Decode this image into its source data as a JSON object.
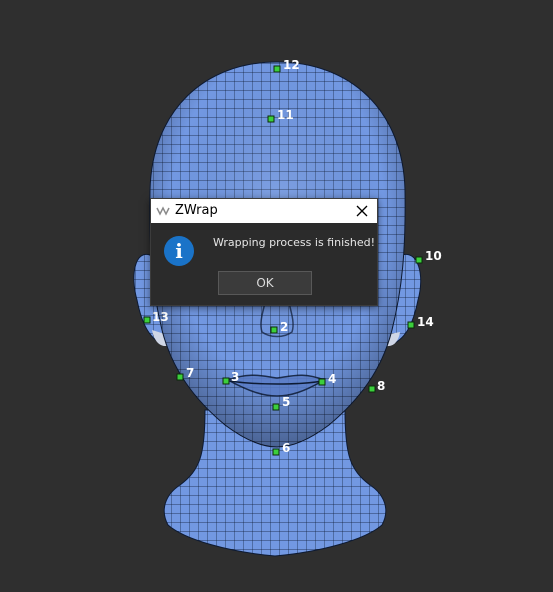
{
  "viewport": {
    "background": "#2f2f2f",
    "mesh_color": "#7298e2",
    "wire_color": "#0d1a33",
    "marker_color": "#3ccf3c",
    "model": "head-mesh",
    "markers": [
      {
        "id": "2",
        "label": "2"
      },
      {
        "id": "3",
        "label": "3"
      },
      {
        "id": "4",
        "label": "4"
      },
      {
        "id": "5",
        "label": "5"
      },
      {
        "id": "6",
        "label": "6"
      },
      {
        "id": "7",
        "label": "7"
      },
      {
        "id": "8",
        "label": "8"
      },
      {
        "id": "10",
        "label": "10"
      },
      {
        "id": "11",
        "label": "11"
      },
      {
        "id": "12",
        "label": "12"
      },
      {
        "id": "13",
        "label": "13"
      },
      {
        "id": "14",
        "label": "14"
      }
    ]
  },
  "dialog": {
    "title": "ZWrap",
    "app_icon": "zwrap-icon",
    "close_icon": "close-icon",
    "info_icon_glyph": "i",
    "message": "Wrapping process is finished!",
    "ok_label": "OK",
    "accent": "#1a73c8"
  }
}
